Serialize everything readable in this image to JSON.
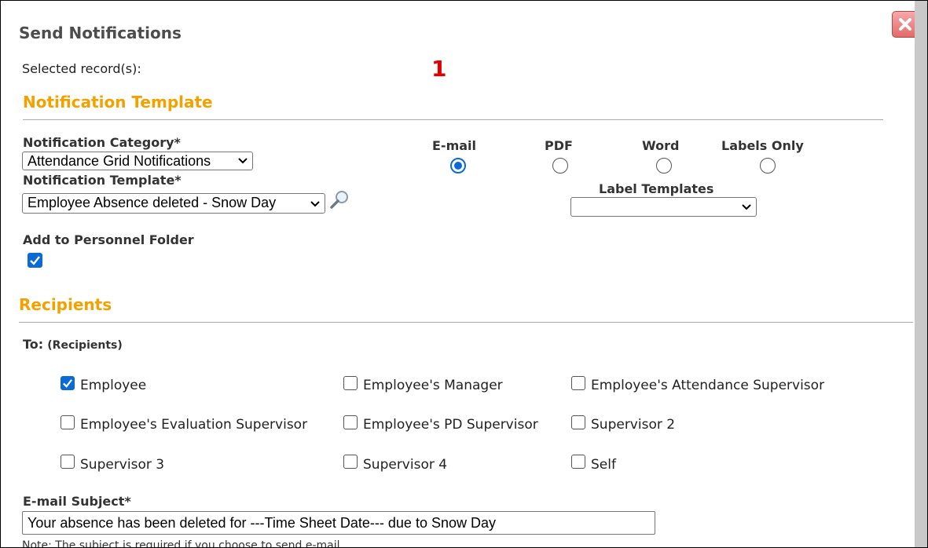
{
  "dialog": {
    "title": "Send Notifications",
    "close_icon": "close-icon"
  },
  "selected": {
    "label": "Selected record(s):",
    "count": "1"
  },
  "template_section": {
    "heading": "Notification Template",
    "category_label": "Notification Category*",
    "category_value": "Attendance Grid Notifications",
    "template_label": "Notification Template*",
    "template_value": "Employee Absence deleted - Snow Day",
    "search_icon": "magnifier-icon",
    "formats": [
      {
        "label": "E-mail",
        "selected": true
      },
      {
        "label": "PDF",
        "selected": false
      },
      {
        "label": "Word",
        "selected": false
      },
      {
        "label": "Labels Only",
        "selected": false
      }
    ],
    "label_templates_label": "Label Templates",
    "label_templates_value": "",
    "personnel_label": "Add to Personnel Folder",
    "personnel_checked": true
  },
  "recipients": {
    "heading": "Recipients",
    "to_label": "To:",
    "to_sub": "(Recipients)",
    "options": [
      {
        "label": "Employee",
        "checked": true
      },
      {
        "label": "Employee's Manager",
        "checked": false
      },
      {
        "label": "Employee's Attendance Supervisor",
        "checked": false
      },
      {
        "label": "Employee's Evaluation Supervisor",
        "checked": false
      },
      {
        "label": "Employee's PD Supervisor",
        "checked": false
      },
      {
        "label": "Supervisor 2",
        "checked": false
      },
      {
        "label": "Supervisor 3",
        "checked": false
      },
      {
        "label": "Supervisor 4",
        "checked": false
      },
      {
        "label": "Self",
        "checked": false
      }
    ]
  },
  "email": {
    "subject_label": "E-mail Subject*",
    "subject_value": "Your absence has been deleted for ---Time Sheet Date--- due to Snow Day",
    "note": "Note: The subject is required if you choose to send e-mail"
  },
  "colors": {
    "accent": "#f4a100",
    "count": "#e00000",
    "checked": "#0a6ad6"
  }
}
